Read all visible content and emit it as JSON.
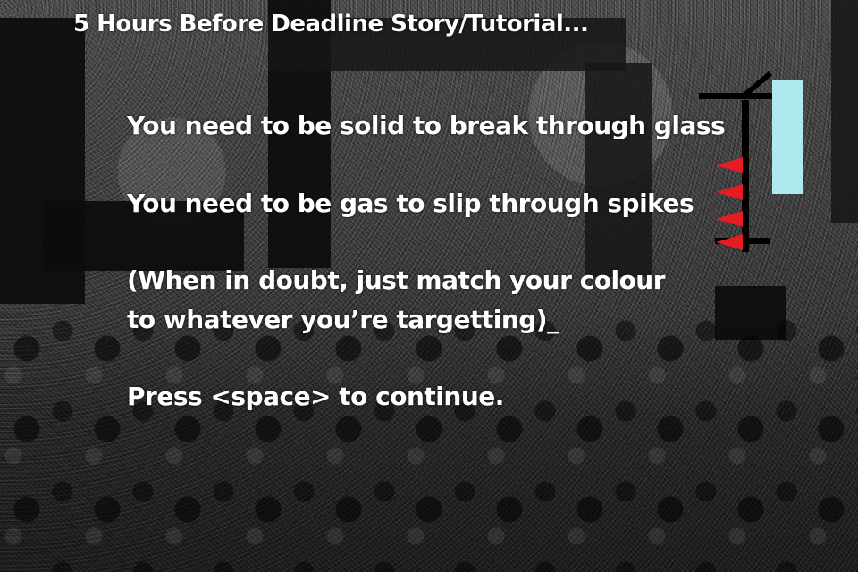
{
  "game": {
    "title": "5 Hours Before Deadline Story/Tutorial...",
    "lines": [
      "You need to be solid to break through glass",
      "You need to be gas to slip through spikes",
      "(When in doubt, just match your colour",
      "to whatever you’re targetting)_",
      "Press <space> to continue."
    ]
  },
  "colors": {
    "glass": "#aee9ef",
    "spikes": "#e51c24",
    "text": "#ffffff",
    "walls": "#0c0c0c"
  }
}
